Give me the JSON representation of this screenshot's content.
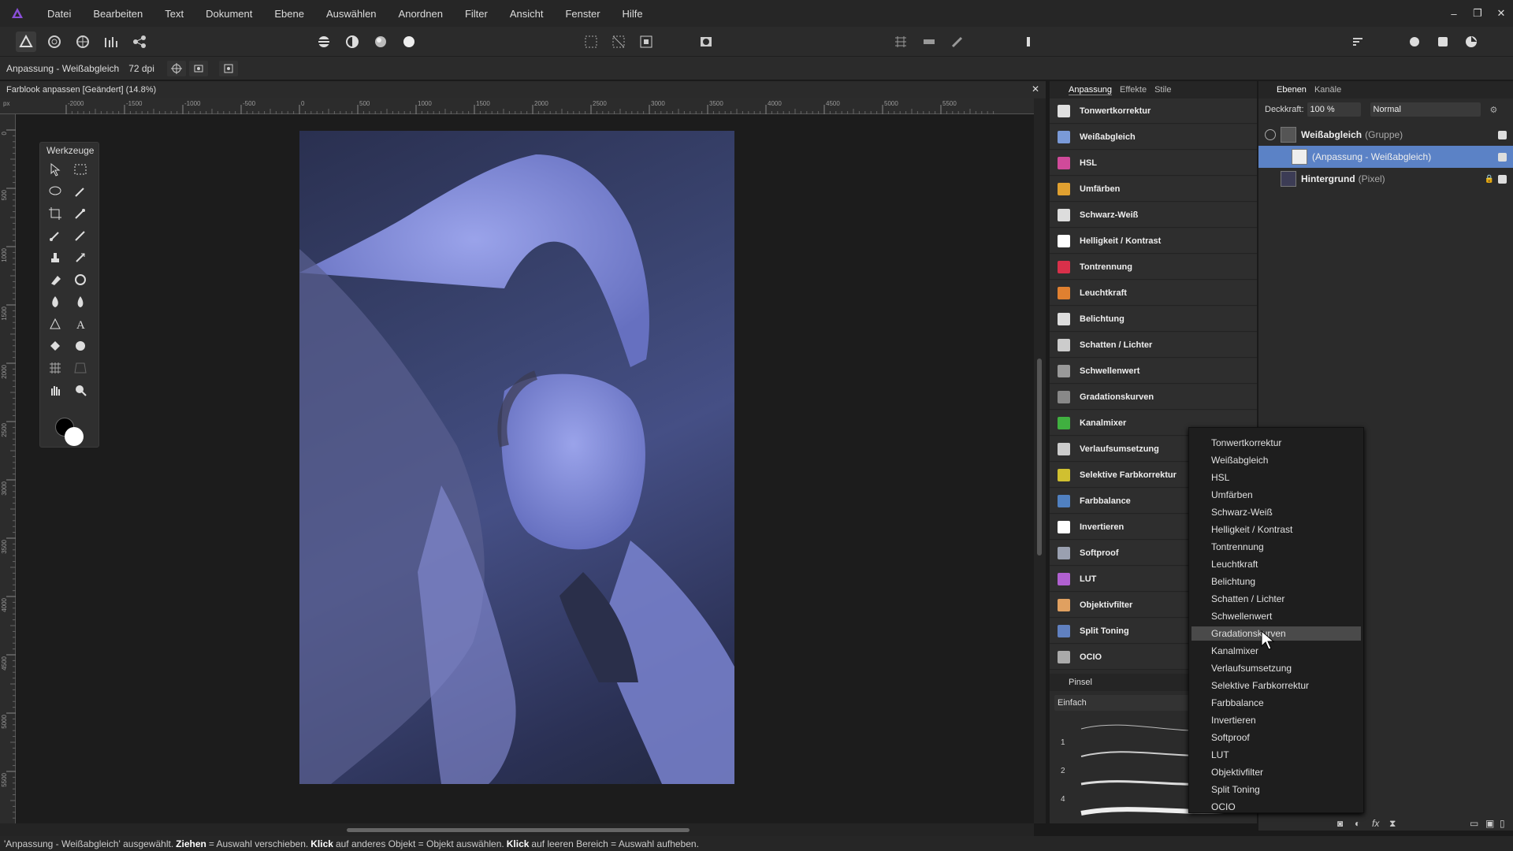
{
  "menu": {
    "items": [
      "Datei",
      "Bearbeiten",
      "Text",
      "Dokument",
      "Ebene",
      "Auswählen",
      "Anordnen",
      "Filter",
      "Ansicht",
      "Fenster",
      "Hilfe"
    ]
  },
  "window_controls": {
    "minimize": "–",
    "restore": "❐",
    "close": "✕"
  },
  "context": {
    "label": "Anpassung - Weißabgleich",
    "dpi": "72 dpi"
  },
  "document": {
    "title": "Farblook anpassen [Geändert] (14.8%)",
    "close": "✕"
  },
  "ruler": {
    "unit": "px",
    "top_ticks": [
      "-2000",
      "-1500",
      "-1000",
      "-500",
      "0",
      "500",
      "1000",
      "1500",
      "2000",
      "2500",
      "3000",
      "3500",
      "4000",
      "4500",
      "5000",
      "5500"
    ],
    "left_ticks": [
      "0",
      "500",
      "1000",
      "1500",
      "2000",
      "2500",
      "3000",
      "3500",
      "4000",
      "4500",
      "5000",
      "5500"
    ]
  },
  "tools_panel": {
    "title": "Werkzeuge"
  },
  "adjustment_panel": {
    "tabs": [
      "Anpassung",
      "Effekte",
      "Stile"
    ],
    "items": [
      {
        "label": "Tonwertkorrektur",
        "color": "#e0e0e0"
      },
      {
        "label": "Weißabgleich",
        "color": "#7a9ad8"
      },
      {
        "label": "HSL",
        "color": "#d04a9a"
      },
      {
        "label": "Umfärben",
        "color": "#e0a030"
      },
      {
        "label": "Schwarz-Weiß",
        "color": "#dddddd"
      },
      {
        "label": "Helligkeit / Kontrast",
        "color": "#ffffff"
      },
      {
        "label": "Tontrennung",
        "color": "#d8304a"
      },
      {
        "label": "Leuchtkraft",
        "color": "#e08030"
      },
      {
        "label": "Belichtung",
        "color": "#dddddd"
      },
      {
        "label": "Schatten / Lichter",
        "color": "#cccccc"
      },
      {
        "label": "Schwellenwert",
        "color": "#999999"
      },
      {
        "label": "Gradationskurven",
        "color": "#888888"
      },
      {
        "label": "Kanalmixer",
        "color": "#40b040"
      },
      {
        "label": "Verlaufsumsetzung",
        "color": "#cccccc"
      },
      {
        "label": "Selektive Farbkorrektur",
        "color": "#d0c030"
      },
      {
        "label": "Farbbalance",
        "color": "#5080c0"
      },
      {
        "label": "Invertieren",
        "color": "#ffffff"
      },
      {
        "label": "Softproof",
        "color": "#9aa0b0"
      },
      {
        "label": "LUT",
        "color": "#b060d0"
      },
      {
        "label": "Objektivfilter",
        "color": "#e0a060"
      },
      {
        "label": "Split Toning",
        "color": "#6080c0"
      },
      {
        "label": "OCIO",
        "color": "#aaaaaa"
      }
    ]
  },
  "brush_panel": {
    "title": "Pinsel",
    "category": "Einfach",
    "sizes": [
      "1",
      "2",
      "4"
    ]
  },
  "layers_panel": {
    "tabs": [
      "Ebenen",
      "Kanäle"
    ],
    "opacity_label": "Deckkraft:",
    "opacity_value": "100 %",
    "blend_mode": "Normal",
    "layers": [
      {
        "name": "Weißabgleich",
        "type": "(Gruppe)",
        "selected": false
      },
      {
        "name": "(Anpassung - Weißabgleich)",
        "type": "",
        "selected": true
      },
      {
        "name": "Hintergrund",
        "type": "(Pixel)",
        "selected": false
      }
    ]
  },
  "popup_menu": {
    "items": [
      "Tonwertkorrektur",
      "Weißabgleich",
      "HSL",
      "Umfärben",
      "Schwarz-Weiß",
      "Helligkeit / Kontrast",
      "Tontrennung",
      "Leuchtkraft",
      "Belichtung",
      "Schatten / Lichter",
      "Schwellenwert",
      "Gradationskurven",
      "Kanalmixer",
      "Verlaufsumsetzung",
      "Selektive Farbkorrektur",
      "Farbbalance",
      "Invertieren",
      "Softproof",
      "LUT",
      "Objektivfilter",
      "Split Toning",
      "OCIO"
    ],
    "highlighted": "Gradationskurven"
  },
  "status": {
    "part1": "'Anpassung - Weißabgleich' ausgewählt.",
    "b1": "Ziehen",
    "part2": "= Auswahl verschieben.",
    "b2": "Klick",
    "part3": "auf anderes Objekt = Objekt auswählen.",
    "b3": "Klick",
    "part4": "auf leeren Bereich = Auswahl aufheben."
  },
  "colors": {
    "accent": "#4a7ec8",
    "selection": "#5b82c6",
    "photo_tint": "#6670c0"
  }
}
